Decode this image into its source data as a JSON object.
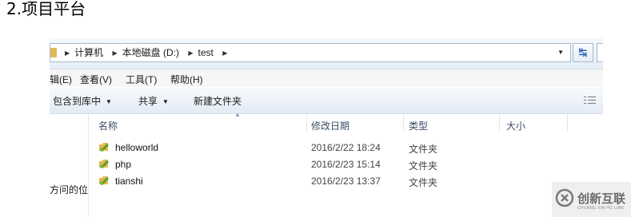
{
  "heading": "2.项目平台",
  "address_bar": {
    "crumbs": [
      "计算机",
      "本地磁盘 (D:)",
      "test"
    ]
  },
  "menu": [
    "辑(E)",
    "查看(V)",
    "工具(T)",
    "帮助(H)"
  ],
  "toolbar": {
    "include_library": "包含到库中",
    "share": "共享",
    "new_folder": "新建文件夹"
  },
  "nav_pane": {
    "partial_text": "方问的位"
  },
  "columns": {
    "name": "名称",
    "date": "修改日期",
    "type": "类型",
    "size": "大小"
  },
  "files": [
    {
      "name": "helloworld",
      "date": "2016/2/22 18:24",
      "type": "文件夹"
    },
    {
      "name": "php",
      "date": "2016/2/23 15:14",
      "type": "文件夹"
    },
    {
      "name": "tianshi",
      "date": "2016/2/23 13:37",
      "type": "文件夹"
    }
  ],
  "watermark": {
    "text": "创新互联",
    "subtext": "CHUANG XIN HU LIAN"
  },
  "colors": {
    "folder_green": "#5a9a2a",
    "folder_yellow": "#e3b94b",
    "header_text": "#3a4d66"
  }
}
